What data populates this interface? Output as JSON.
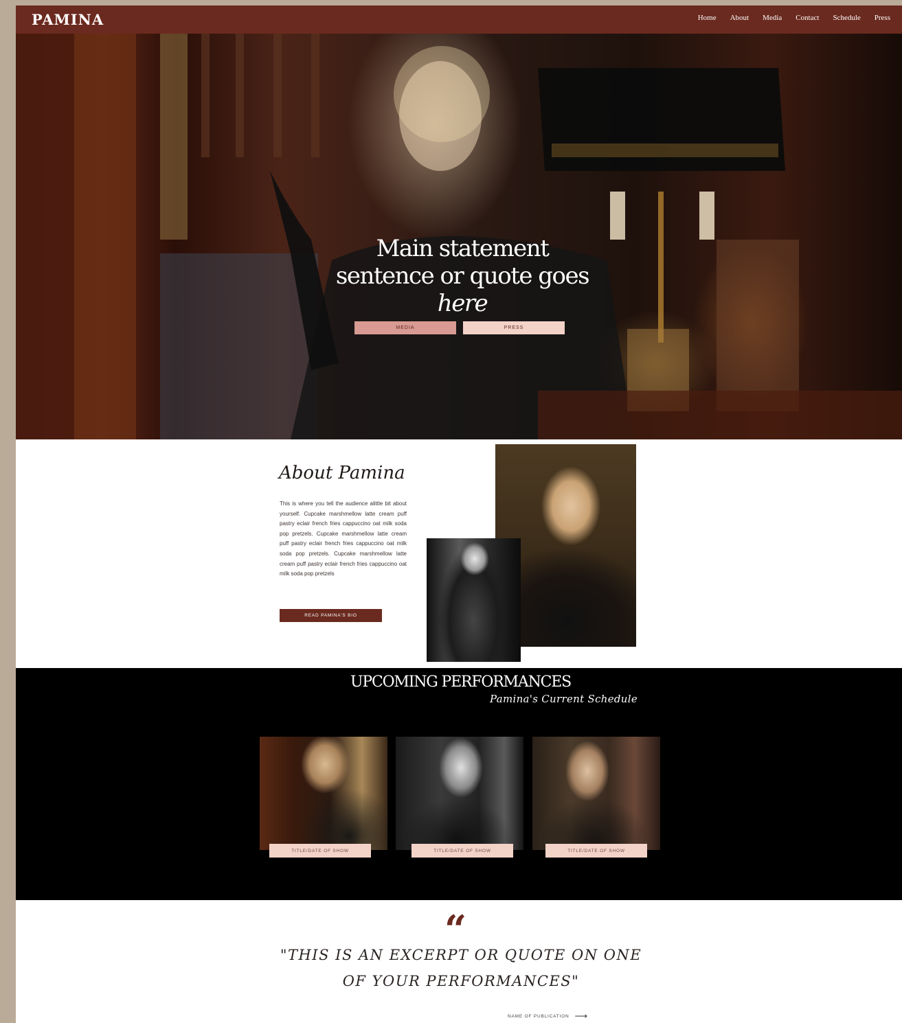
{
  "nav": {
    "logo": "PAMINA",
    "links": [
      "Home",
      "About",
      "Media",
      "Contact",
      "Schedule",
      "Press"
    ]
  },
  "hero": {
    "title_line1": "Main statement",
    "title_line2": "sentence or quote goes",
    "title_line3": "here",
    "buttons": {
      "media": "MEDIA",
      "press": "PRESS"
    }
  },
  "about": {
    "title": "About Pamina",
    "text": "This is where you tell the audience alittle bit about yourself. Cupcake marshmellow latte cream puff pastry eclair french fries cappuccino oat milk soda pop pretzels. Cupcake marshmellow latte cream puff pastry eclair french fries cappuccino oat milk soda pop pretzels. Cupcake marshmellow latte cream puff pastry eclair french fries cappuccino oat milk soda pop pretzels",
    "button": "READ PAMINA'S BIO"
  },
  "performances": {
    "title": "UPCOMING PERFORMANCES",
    "subtitle": "Pamina's Current Schedule",
    "shows": [
      {
        "label": "TITLE/DATE OF SHOW"
      },
      {
        "label": "TITLE/DATE OF SHOW"
      },
      {
        "label": "TITLE/DATE OF SHOW"
      }
    ]
  },
  "quote": {
    "mark": "“",
    "text": "\"THIS IS AN EXCERPT OR QUOTE ON ONE OF YOUR PERFORMANCES\"",
    "publication": "NAME OF PUBLICATION",
    "arrow_icon": "arrow-right-icon"
  },
  "colors": {
    "brand": "#6b2a1f",
    "blush": "#f3d2c8",
    "rose": "#d89a92",
    "frame": "#b9ab98"
  }
}
